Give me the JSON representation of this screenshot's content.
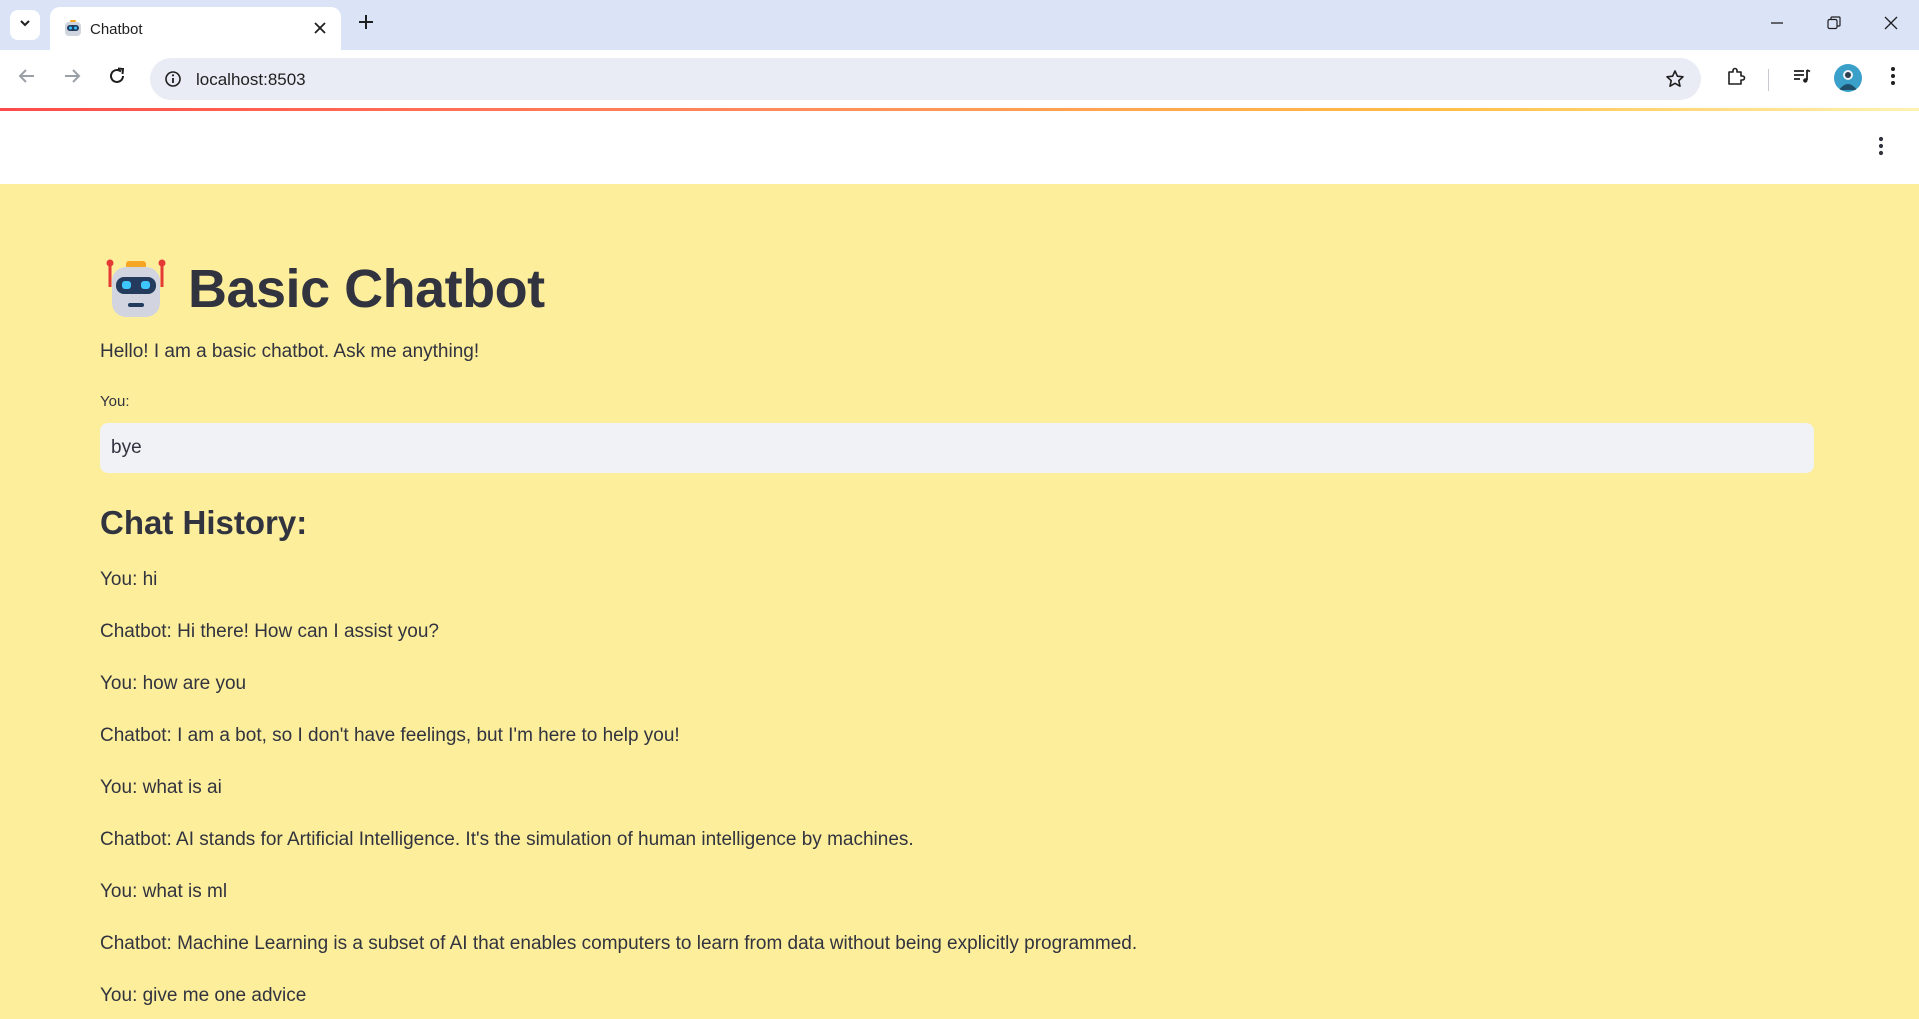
{
  "browser": {
    "tab_title": "Chatbot",
    "url": "localhost:8503"
  },
  "app": {
    "title": "Basic Chatbot",
    "intro": "Hello! I am a basic chatbot. Ask me anything!",
    "input_label": "You:",
    "input_value": "bye",
    "history_heading": "Chat History:",
    "history": [
      "You: hi",
      "Chatbot: Hi there! How can I assist you?",
      "You: how are you",
      "Chatbot: I am a bot, so I don't have feelings, but I'm here to help you!",
      "You: what is ai",
      "Chatbot: AI stands for Artificial Intelligence. It's the simulation of human intelligence by machines.",
      "You: what is ml",
      "Chatbot: Machine Learning is a subset of AI that enables computers to learn from data without being explicitly programmed.",
      "You: give me one advice"
    ]
  },
  "colors": {
    "page_background": "#fdee9b",
    "text": "#31333f",
    "input_background": "#f0f2f6",
    "tabstrip": "#dbe3f7"
  }
}
